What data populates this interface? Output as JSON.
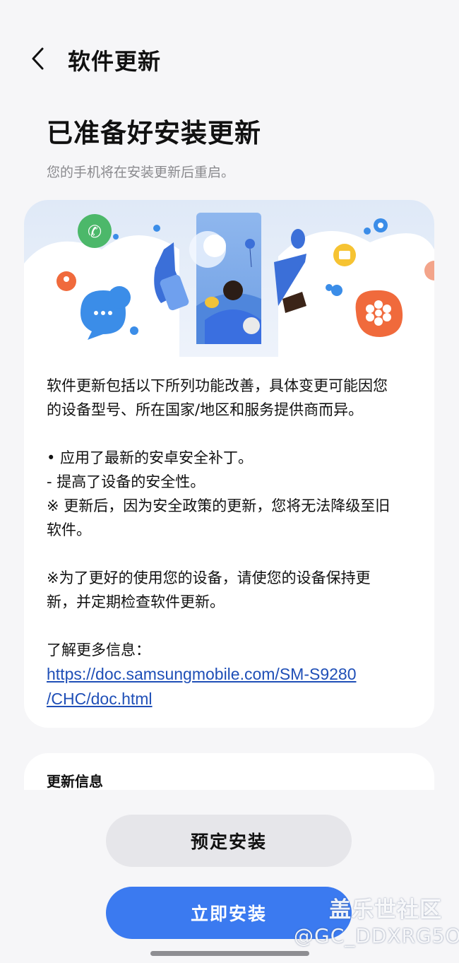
{
  "header": {
    "title": "软件更新"
  },
  "page": {
    "title": "已准备好安装更新",
    "subtitle": "您的手机将在安装更新后重启。"
  },
  "details": {
    "intro_line1": "软件更新包括以下所列功能改善，具体变更可能因您",
    "intro_line2": "的设备型号、所在国家/地区和服务提供商而异。",
    "bullet_1": "• 应用了最新的安卓安全补丁。",
    "bullet_1_sub": " - 提高了设备的安全性。",
    "note_1_line1": "※ 更新后，因为安全政策的更新，您将无法降级至旧",
    "note_1_line2": "软件。",
    "note_2_line1": "※为了更好的使用您的设备，请使您的设备保持更",
    "note_2_line2": "新，并定期检查软件更新。",
    "more_info_label": "了解更多信息：",
    "link_line1": "https://doc.samsungmobile.com/SM-S9280",
    "link_line2": "/CHC/doc.html"
  },
  "update_info": {
    "title": "更新信息"
  },
  "buttons": {
    "schedule": "预定安装",
    "install_now": "立即安装"
  },
  "watermark": {
    "community": "盖乐世社区",
    "handle": "@GC_DDXRG5O"
  },
  "colors": {
    "accent": "#3b7af0",
    "link": "#1f4fb7",
    "background": "#f6f6f8"
  },
  "icons": {
    "back": "chevron-left-icon"
  }
}
